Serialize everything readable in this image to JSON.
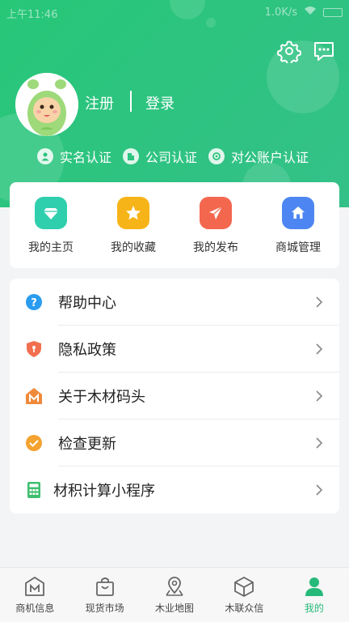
{
  "status_bar": {
    "time": "上午11:46",
    "network_speed": "1.0K/s"
  },
  "profile": {
    "register_label": "注册",
    "login_label": "登录"
  },
  "certifications": [
    {
      "label": "实名认证",
      "icon": "person-icon"
    },
    {
      "label": "公司认证",
      "icon": "company-icon"
    },
    {
      "label": "对公账户认证",
      "icon": "account-icon"
    }
  ],
  "quick_actions": [
    {
      "label": "我的主页",
      "icon": "diamond-icon",
      "color": "#2fcfae"
    },
    {
      "label": "我的收藏",
      "icon": "star-icon",
      "color": "#f7b418"
    },
    {
      "label": "我的发布",
      "icon": "send-icon",
      "color": "#f3674f"
    },
    {
      "label": "商城管理",
      "icon": "home-icon",
      "color": "#4d86f2"
    }
  ],
  "menu": [
    {
      "label": "帮助中心",
      "icon": "help-icon",
      "color": "#2a9cf0"
    },
    {
      "label": "隐私政策",
      "icon": "shield-icon",
      "color": "#f16f4f"
    },
    {
      "label": "关于木材码头",
      "icon": "logo-m-icon",
      "color": "#f08a3b"
    },
    {
      "label": "检查更新",
      "icon": "check-icon",
      "color": "#f4a230"
    },
    {
      "label": "材积计算小程序",
      "icon": "calculator-icon",
      "color": "#3fbf6f"
    }
  ],
  "tabs": [
    {
      "label": "商机信息",
      "icon": "m-box-icon",
      "active": false
    },
    {
      "label": "现货市场",
      "icon": "bag-icon",
      "active": false
    },
    {
      "label": "木业地图",
      "icon": "map-icon",
      "active": false
    },
    {
      "label": "木联众信",
      "icon": "cube-icon",
      "active": false
    },
    {
      "label": "我的",
      "icon": "user-icon",
      "active": true
    }
  ],
  "colors": {
    "brand_green": "#27c778",
    "active_tab": "#27b979"
  }
}
